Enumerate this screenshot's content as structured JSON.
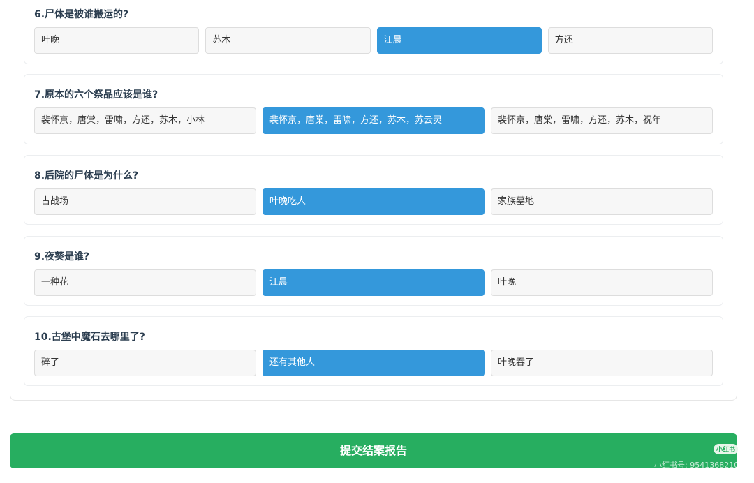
{
  "questions": [
    {
      "title": "6.尸体是被谁搬运的?",
      "options": [
        "叶晚",
        "苏木",
        "江晨",
        "方还"
      ],
      "selected": 2
    },
    {
      "title": "7.原本的六个祭品应该是谁?",
      "options": [
        "裴怀京，唐棠，雷啸，方还，苏木，小林",
        "裴怀京，唐棠，雷啸，方还，苏木，苏云灵",
        "裴怀京，唐棠，雷啸，方还，苏木，祝年"
      ],
      "selected": 1
    },
    {
      "title": "8.后院的尸体是为什么?",
      "options": [
        "古战场",
        "叶晚吃人",
        "家族墓地"
      ],
      "selected": 1
    },
    {
      "title": "9.夜葵是谁?",
      "options": [
        "一种花",
        "江晨",
        "叶晚"
      ],
      "selected": 1
    },
    {
      "title": "10.古堡中魔石去哪里了?",
      "options": [
        "碎了",
        "还有其他人",
        "叶晚吞了"
      ],
      "selected": 1
    }
  ],
  "submit_label": "提交结案报告",
  "watermark": {
    "badge": "小红书",
    "id_text": "小红书号: 9541368210"
  },
  "colors": {
    "selected": "#3498db",
    "submit": "#27ae60"
  }
}
